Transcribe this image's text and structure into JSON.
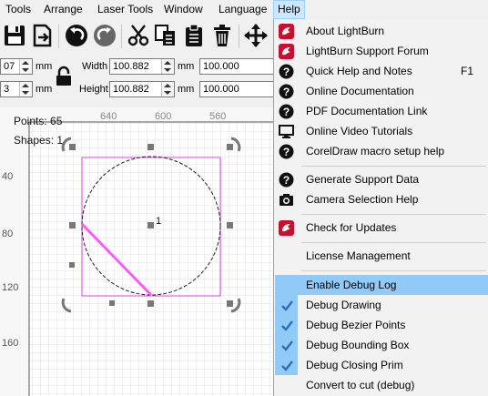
{
  "menubar": {
    "items": [
      {
        "label": "Tools"
      },
      {
        "label": "Arrange"
      },
      {
        "label": "Laser Tools"
      },
      {
        "label": "Window"
      },
      {
        "label": "Language"
      },
      {
        "label": "Help"
      }
    ]
  },
  "props": {
    "x_value": "07",
    "y_value": "3",
    "unit": "mm",
    "width_label": "Width",
    "width_value": "100.882",
    "height_label": "Height",
    "height_value": "100.882",
    "scale_w": "100.000",
    "scale_h": "100.000"
  },
  "canvas": {
    "ruler_top": [
      "640",
      "600",
      "560"
    ],
    "ruler_left": [
      "40",
      "80",
      "120",
      "160"
    ],
    "points_text": "Points: 65",
    "shapes_text": "Shapes: 1",
    "shape_number": "1",
    "selection_color": "#e040e0",
    "line_color": "#ff5aff"
  },
  "help_menu": {
    "items": [
      {
        "label": "About LightBurn",
        "icon": "lightburn-logo-icon"
      },
      {
        "label": "LightBurn Support Forum",
        "icon": "lightburn-logo-icon"
      },
      {
        "label": "Quick Help and Notes",
        "icon": "help-circle-icon",
        "shortcut": "F1"
      },
      {
        "label": "Online Documentation",
        "icon": "help-circle-icon"
      },
      {
        "label": "PDF Documentation Link",
        "icon": "help-circle-icon"
      },
      {
        "label": "Online Video Tutorials",
        "icon": "monitor-icon"
      },
      {
        "label": "CorelDraw macro setup help",
        "icon": "help-circle-icon"
      },
      {
        "label": "Generate Support Data",
        "icon": "help-circle-icon"
      },
      {
        "label": "Camera Selection Help",
        "icon": "camera-icon"
      },
      {
        "label": "Check for Updates",
        "icon": "lightburn-logo-icon"
      },
      {
        "label": "License Management"
      },
      {
        "label": "Enable Debug Log",
        "highlighted": true
      },
      {
        "label": "Debug Drawing",
        "checked": true
      },
      {
        "label": "Debug Bezier Points",
        "checked": true
      },
      {
        "label": "Debug Bounding Box",
        "checked": true
      },
      {
        "label": "Debug Closing Prim",
        "checked": true
      },
      {
        "label": "Convert to cut (debug)"
      }
    ]
  },
  "colors": {
    "menu_highlight": "#91c9f7",
    "check_color": "#2a6fb8",
    "logo_red": "#c8102e"
  }
}
